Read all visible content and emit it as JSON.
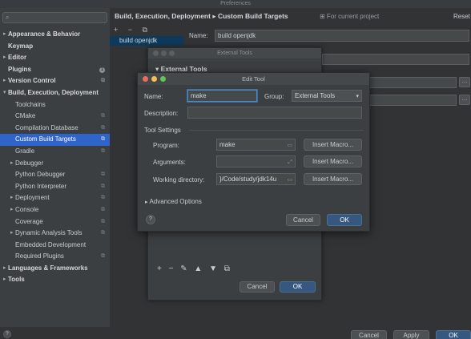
{
  "window": {
    "title": "Preferences"
  },
  "search": {
    "placeholder": "",
    "icon": "search-icon"
  },
  "sidebar": {
    "items": [
      {
        "label": "Appearance & Behavior",
        "level": 0,
        "bold": true,
        "arrow": "▸"
      },
      {
        "label": "Keymap",
        "level": 0,
        "bold": true,
        "arrow": ""
      },
      {
        "label": "Editor",
        "level": 0,
        "bold": true,
        "arrow": "▸"
      },
      {
        "label": "Plugins",
        "level": 0,
        "bold": true,
        "arrow": "",
        "badge": "1"
      },
      {
        "label": "Version Control",
        "level": 0,
        "bold": true,
        "arrow": "▸",
        "mark": "⧉"
      },
      {
        "label": "Build, Execution, Deployment",
        "level": 0,
        "bold": true,
        "arrow": "▾"
      },
      {
        "label": "Toolchains",
        "level": 1,
        "arrow": ""
      },
      {
        "label": "CMake",
        "level": 1,
        "arrow": "",
        "mark": "⧉"
      },
      {
        "label": "Compilation Database",
        "level": 1,
        "arrow": "",
        "mark": "⧉"
      },
      {
        "label": "Custom Build Targets",
        "level": 1,
        "arrow": "",
        "mark": "⧉",
        "selected": true
      },
      {
        "label": "Gradle",
        "level": 1,
        "arrow": "",
        "mark": "⧉"
      },
      {
        "label": "Debugger",
        "level": 1,
        "arrow": "▸"
      },
      {
        "label": "Python Debugger",
        "level": 1,
        "arrow": "",
        "mark": "⧉"
      },
      {
        "label": "Python Interpreter",
        "level": 1,
        "arrow": "",
        "mark": "⧉"
      },
      {
        "label": "Deployment",
        "level": 1,
        "arrow": "▸",
        "mark": "⧉"
      },
      {
        "label": "Console",
        "level": 1,
        "arrow": "▸",
        "mark": "⧉"
      },
      {
        "label": "Coverage",
        "level": 1,
        "arrow": "",
        "mark": "⧉"
      },
      {
        "label": "Dynamic Analysis Tools",
        "level": 1,
        "arrow": "▸",
        "mark": "⧉"
      },
      {
        "label": "Embedded Development",
        "level": 1,
        "arrow": ""
      },
      {
        "label": "Required Plugins",
        "level": 1,
        "arrow": "",
        "mark": "⧉"
      },
      {
        "label": "Languages & Frameworks",
        "level": 0,
        "bold": true,
        "arrow": "▸"
      },
      {
        "label": "Tools",
        "level": 0,
        "bold": true,
        "arrow": "▸"
      }
    ]
  },
  "main": {
    "breadcrumb": "Build, Execution, Deployment  ▸  Custom Build Targets",
    "scope": "⊞ For current project",
    "reset": "Reset",
    "toolbar": "+ − ⧉",
    "target_item": "build openjdk",
    "name_label": "Name:",
    "name_value": "build openjdk"
  },
  "external_tools": {
    "title": "External Tools",
    "heading": "▾  External Tools",
    "toolbar": "+ − ✎ ▲ ▼ ⧉",
    "cancel": "Cancel",
    "ok": "OK"
  },
  "edit_tool": {
    "title": "Edit Tool",
    "name_label": "Name:",
    "name_value": "make",
    "group_label": "Group:",
    "group_value": "External Tools",
    "description_label": "Description:",
    "description_value": "",
    "tool_settings": "Tool Settings",
    "program_label": "Program:",
    "program_value": "make",
    "arguments_label": "Arguments:",
    "arguments_value": "",
    "workdir_label": "Working directory:",
    "workdir_value": "}/Code/study/jdk14u",
    "insert_macro": "Insert Macro...",
    "advanced": "Advanced Options",
    "help": "?",
    "cancel": "Cancel",
    "ok": "OK"
  },
  "bottom": {
    "help": "?",
    "cancel": "Cancel",
    "apply": "Apply",
    "ok": "OK"
  },
  "colors": {
    "accent": "#2f65ca",
    "ok_button": "#365880",
    "focus": "#4a88c7"
  }
}
